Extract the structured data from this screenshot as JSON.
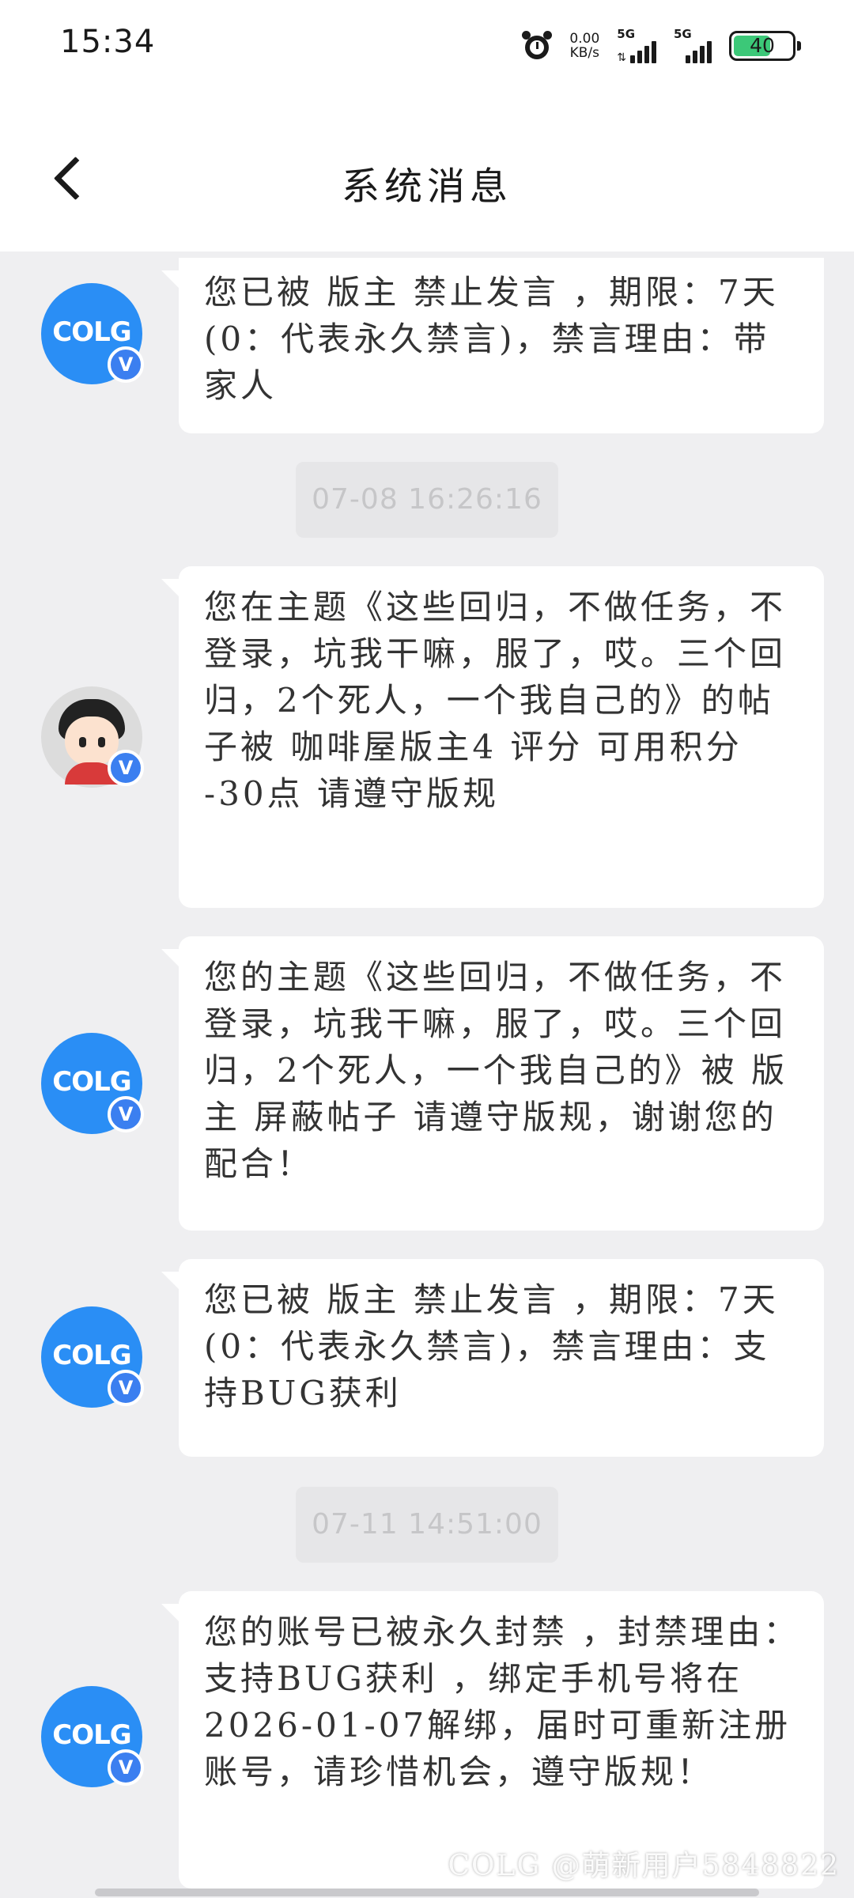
{
  "status_bar": {
    "time": "15:34",
    "net_speed_value": "0.00",
    "net_speed_unit": "KB/s",
    "sim1_label": "5G",
    "sim2_label": "5G",
    "battery_level": "40"
  },
  "header": {
    "title": "系统消息"
  },
  "messages": [
    {
      "avatar": "colg-logo",
      "text": "您已被 版主 禁止发言 ，期限：7天(0：代表永久禁言)，禁言理由：带家人"
    },
    {
      "avatar": "user-cartoon",
      "text": "您在主题《这些回归，不做任务，不登录，坑我干嘛，服了，哎。三个回归，2个死人，一个我自己的》的帖子被 咖啡屋版主4 评分 可用积分 -30点 请遵守版规"
    },
    {
      "avatar": "colg-logo",
      "text": "您的主题《这些回归，不做任务，不登录，坑我干嘛，服了，哎。三个回归，2个死人，一个我自己的》被 版主 屏蔽帖子 请遵守版规，谢谢您的配合！"
    },
    {
      "avatar": "colg-logo",
      "text": "您已被 版主 禁止发言 ，期限：7天(0：代表永久禁言)，禁言理由：支持BUG获利"
    },
    {
      "avatar": "colg-logo",
      "text": "您的账号已被永久封禁 ，封禁理由：支持BUG获利 ，绑定手机号将在2026-01-07解绑，届时可重新注册账号，请珍惜机会，遵守版规！"
    }
  ],
  "timestamps": [
    "07-08 16:26:16",
    "07-11 14:51:00"
  ],
  "avatar_logo_text": "COLG",
  "verified_badge": "V",
  "watermark": "COLG @萌新用户5848822",
  "colors": {
    "brand_blue": "#2a8ef5",
    "battery_green": "#3cc878",
    "background": "#efeff1"
  }
}
